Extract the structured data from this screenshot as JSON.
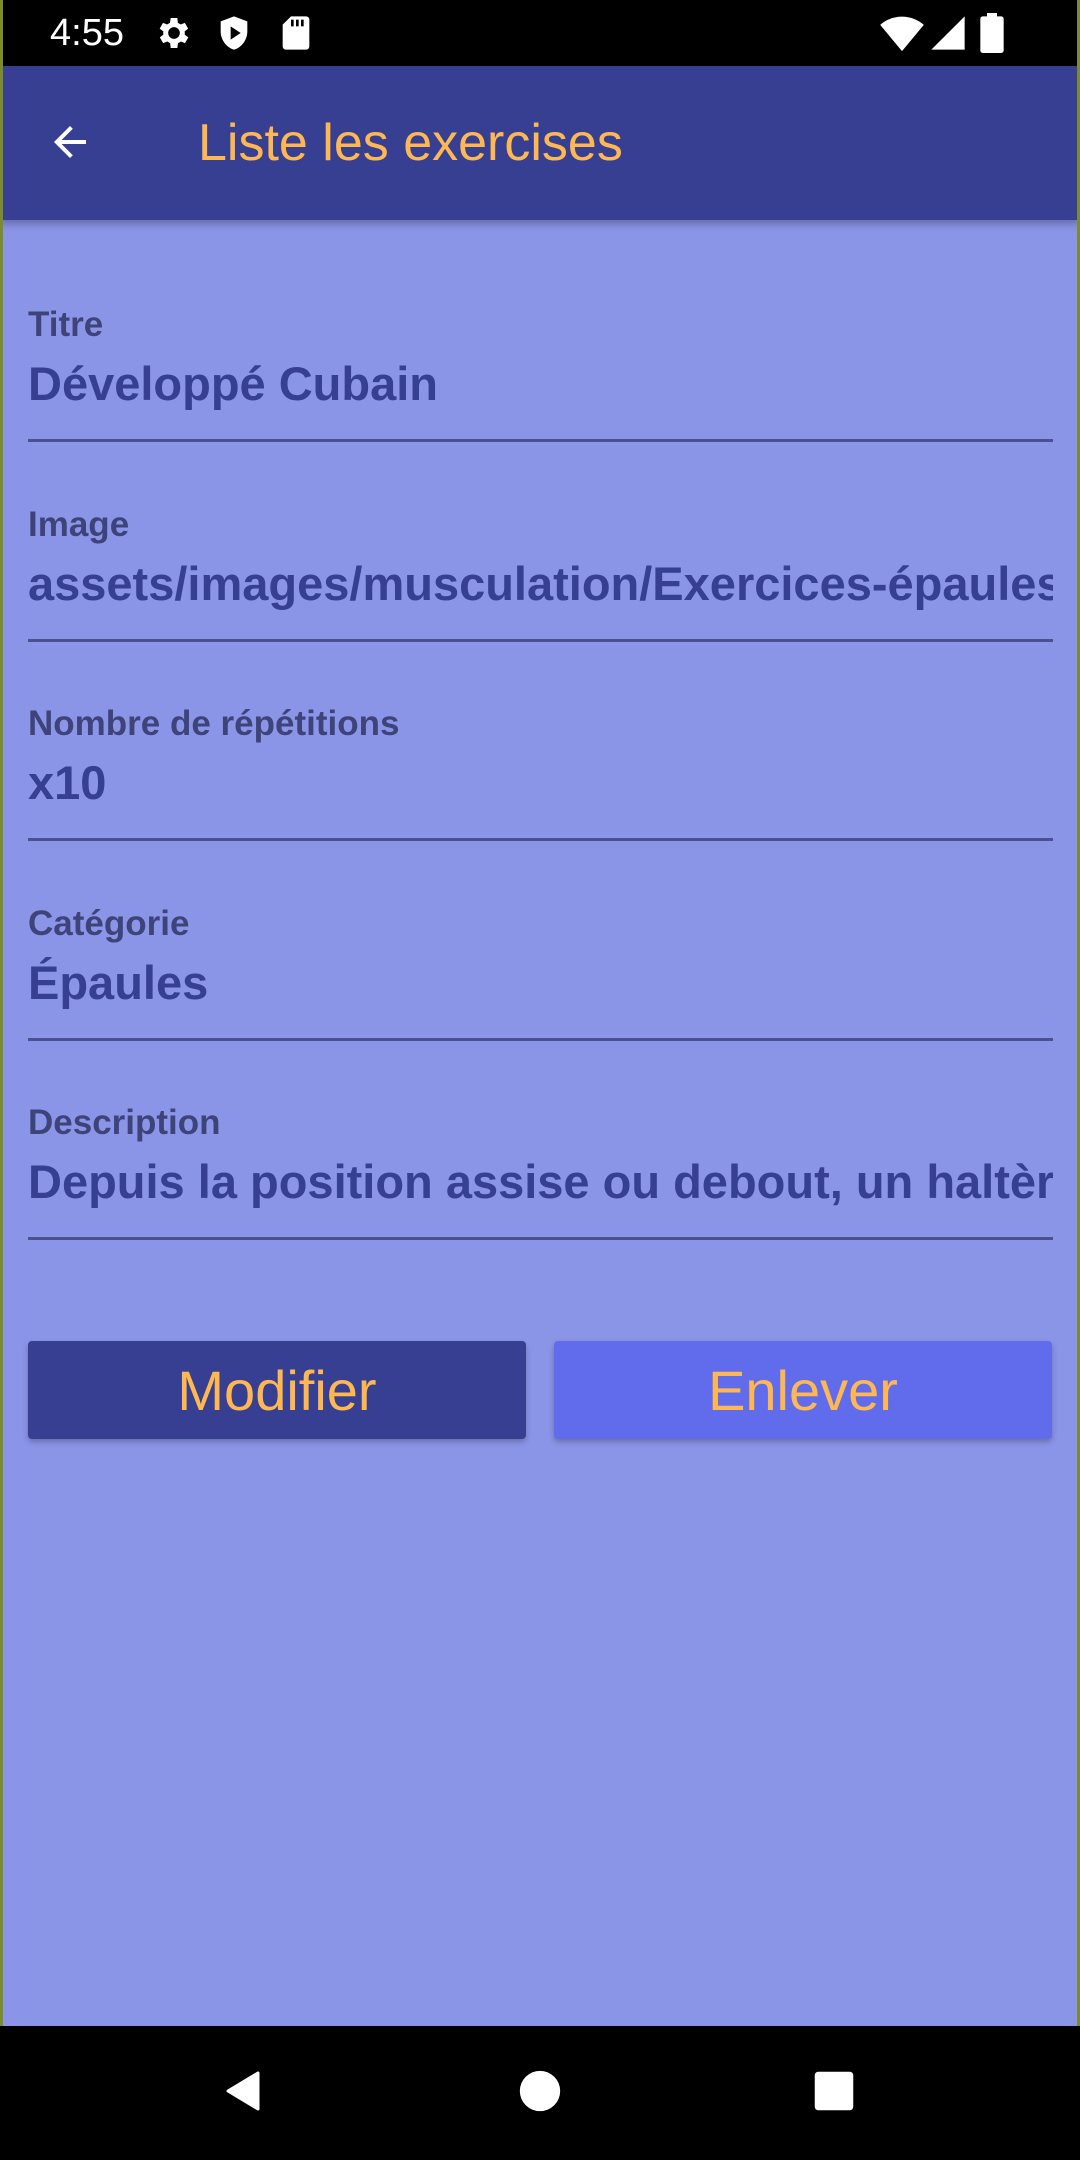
{
  "status_bar": {
    "time": "4:55",
    "left_icons": [
      "settings-icon",
      "play-protect-icon",
      "sd-card-icon"
    ],
    "right_icons": [
      "wifi-icon",
      "signal-icon",
      "battery-icon"
    ]
  },
  "app_bar": {
    "back_icon": "arrow-back-icon",
    "title": "Liste les exercises"
  },
  "form": {
    "fields": [
      {
        "label": "Titre",
        "value": "Développé Cubain"
      },
      {
        "label": "Image",
        "value": "assets/images/musculation/Exercices-épaules"
      },
      {
        "label": "Nombre de répétitions",
        "value": "x10"
      },
      {
        "label": "Catégorie",
        "value": "Épaules"
      },
      {
        "label": "Description",
        "value": "Depuis la position assise ou debout, un haltère"
      }
    ]
  },
  "actions": {
    "modify_label": "Modifier",
    "remove_label": "Enlever"
  },
  "nav_bar": {
    "icons": [
      "back-triangle-icon",
      "home-circle-icon",
      "recents-square-icon"
    ]
  },
  "colors": {
    "app_bar": "#363f92",
    "background": "#8b95e8",
    "title_text": "#ffb851",
    "field_value": "#363f92",
    "field_label": "#3e4479",
    "modify_button": "#363f92",
    "remove_button": "#616ced"
  }
}
